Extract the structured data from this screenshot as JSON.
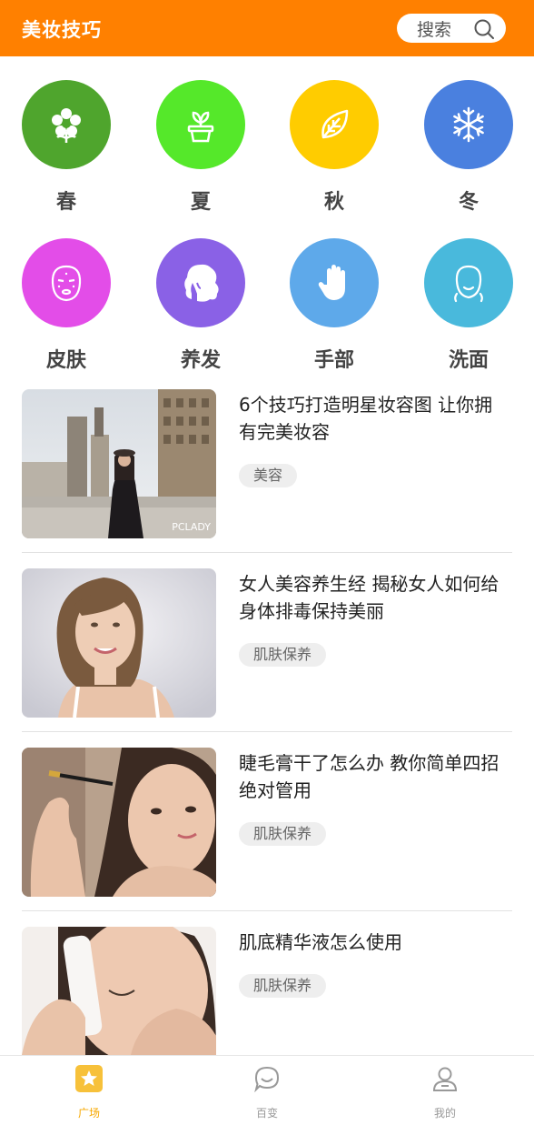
{
  "header": {
    "title": "美妆技巧",
    "search_label": "搜索"
  },
  "categories": [
    {
      "label": "春",
      "icon": "flower-icon",
      "color": "#4fa52d"
    },
    {
      "label": "夏",
      "icon": "potted-plant-icon",
      "color": "#55e82a"
    },
    {
      "label": "秋",
      "icon": "leaf-icon",
      "color": "#ffcc00"
    },
    {
      "label": "冬",
      "icon": "snowflake-icon",
      "color": "#4a80df"
    },
    {
      "label": "皮肤",
      "icon": "face-mask-icon",
      "color": "#e34de8"
    },
    {
      "label": "养发",
      "icon": "hair-icon",
      "color": "#8a61e6"
    },
    {
      "label": "手部",
      "icon": "hand-icon",
      "color": "#5ea9ea"
    },
    {
      "label": "洗面",
      "icon": "face-icon",
      "color": "#49b9dc"
    }
  ],
  "articles": [
    {
      "title": "6个技巧打造明星妆容图 让你拥有完美妆容",
      "tag": "美容",
      "watermark": "PCLADY"
    },
    {
      "title": "女人美容养生经 揭秘女人如何给身体排毒保持美丽",
      "tag": "肌肤保养"
    },
    {
      "title": "睫毛膏干了怎么办 教你简单四招绝对管用",
      "tag": "肌肤保养"
    },
    {
      "title": "肌底精华液怎么使用",
      "tag": "肌肤保养"
    }
  ],
  "nav": [
    {
      "label": "广场",
      "icon": "star-icon",
      "active": true,
      "active_color": "#f7a800"
    },
    {
      "label": "百变",
      "icon": "chat-bubble-icon",
      "active": false
    },
    {
      "label": "我的",
      "icon": "user-icon",
      "active": false
    }
  ]
}
